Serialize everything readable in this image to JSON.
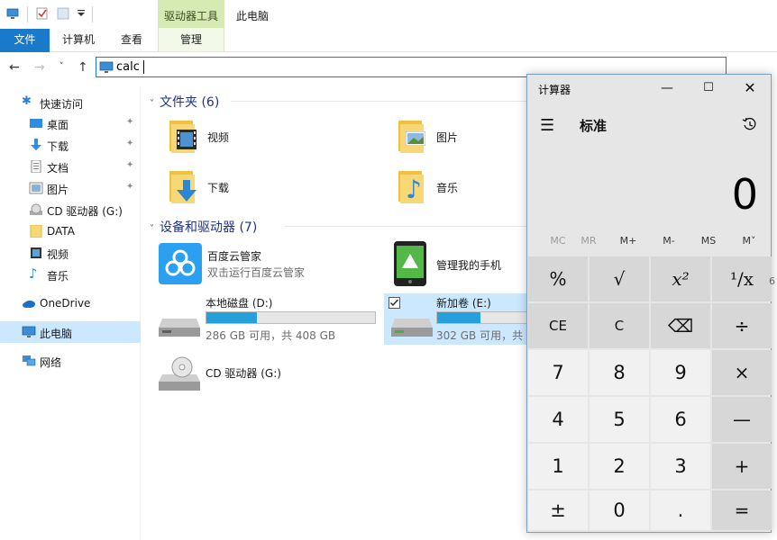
{
  "explorer": {
    "title": "此电脑",
    "context_tab_group": "驱动器工具",
    "tabs": [
      "文件",
      "计算机",
      "查看",
      "管理"
    ],
    "address": {
      "value": "calc"
    },
    "nav": {
      "quick_access": "快速访问",
      "items": [
        {
          "label": "桌面",
          "pinned": true
        },
        {
          "label": "下载",
          "pinned": true
        },
        {
          "label": "文档",
          "pinned": true
        },
        {
          "label": "图片",
          "pinned": true
        },
        {
          "label": "CD 驱动器 (G:)",
          "pinned": false
        },
        {
          "label": "DATA",
          "pinned": false
        },
        {
          "label": "视频",
          "pinned": false
        },
        {
          "label": "音乐",
          "pinned": false
        }
      ],
      "onedrive": "OneDrive",
      "this_pc": "此电脑",
      "network": "网络"
    },
    "folders_header": "文件夹 (6)",
    "folders": [
      "视频",
      "图片",
      "下载",
      "音乐"
    ],
    "devices_header": "设备和驱动器 (7)",
    "apps": [
      {
        "name": "百度云管家",
        "sub": "双击运行百度云管家"
      },
      {
        "name": "管理我的手机"
      }
    ],
    "drives": [
      {
        "name": "本地磁盘 (D:)",
        "sub": "286 GB 可用，共 408 GB",
        "used_fraction": 0.3
      },
      {
        "name": "新加卷 (E:)",
        "sub": "302 GB 可用，共",
        "used_fraction": 0.26
      },
      {
        "name": "CD 驱动器 (G:)"
      }
    ]
  },
  "calculator": {
    "title": "计算器",
    "mode": "标准",
    "display": "0",
    "memory": [
      "MC",
      "MR",
      "M+",
      "M-",
      "MS",
      "M˅"
    ],
    "keys": [
      [
        "%",
        "√",
        "x²",
        "¹/x"
      ],
      [
        "CE",
        "C",
        "⌫",
        "÷"
      ],
      [
        "7",
        "8",
        "9",
        "×"
      ],
      [
        "4",
        "5",
        "6",
        "—"
      ],
      [
        "1",
        "2",
        "3",
        "+"
      ],
      [
        "±",
        "0",
        ".",
        "="
      ]
    ],
    "overflow_digit": "6"
  },
  "colors": {
    "accent": "#1979ca",
    "selection": "#cce8ff",
    "drive_bar": "#26a0da"
  }
}
